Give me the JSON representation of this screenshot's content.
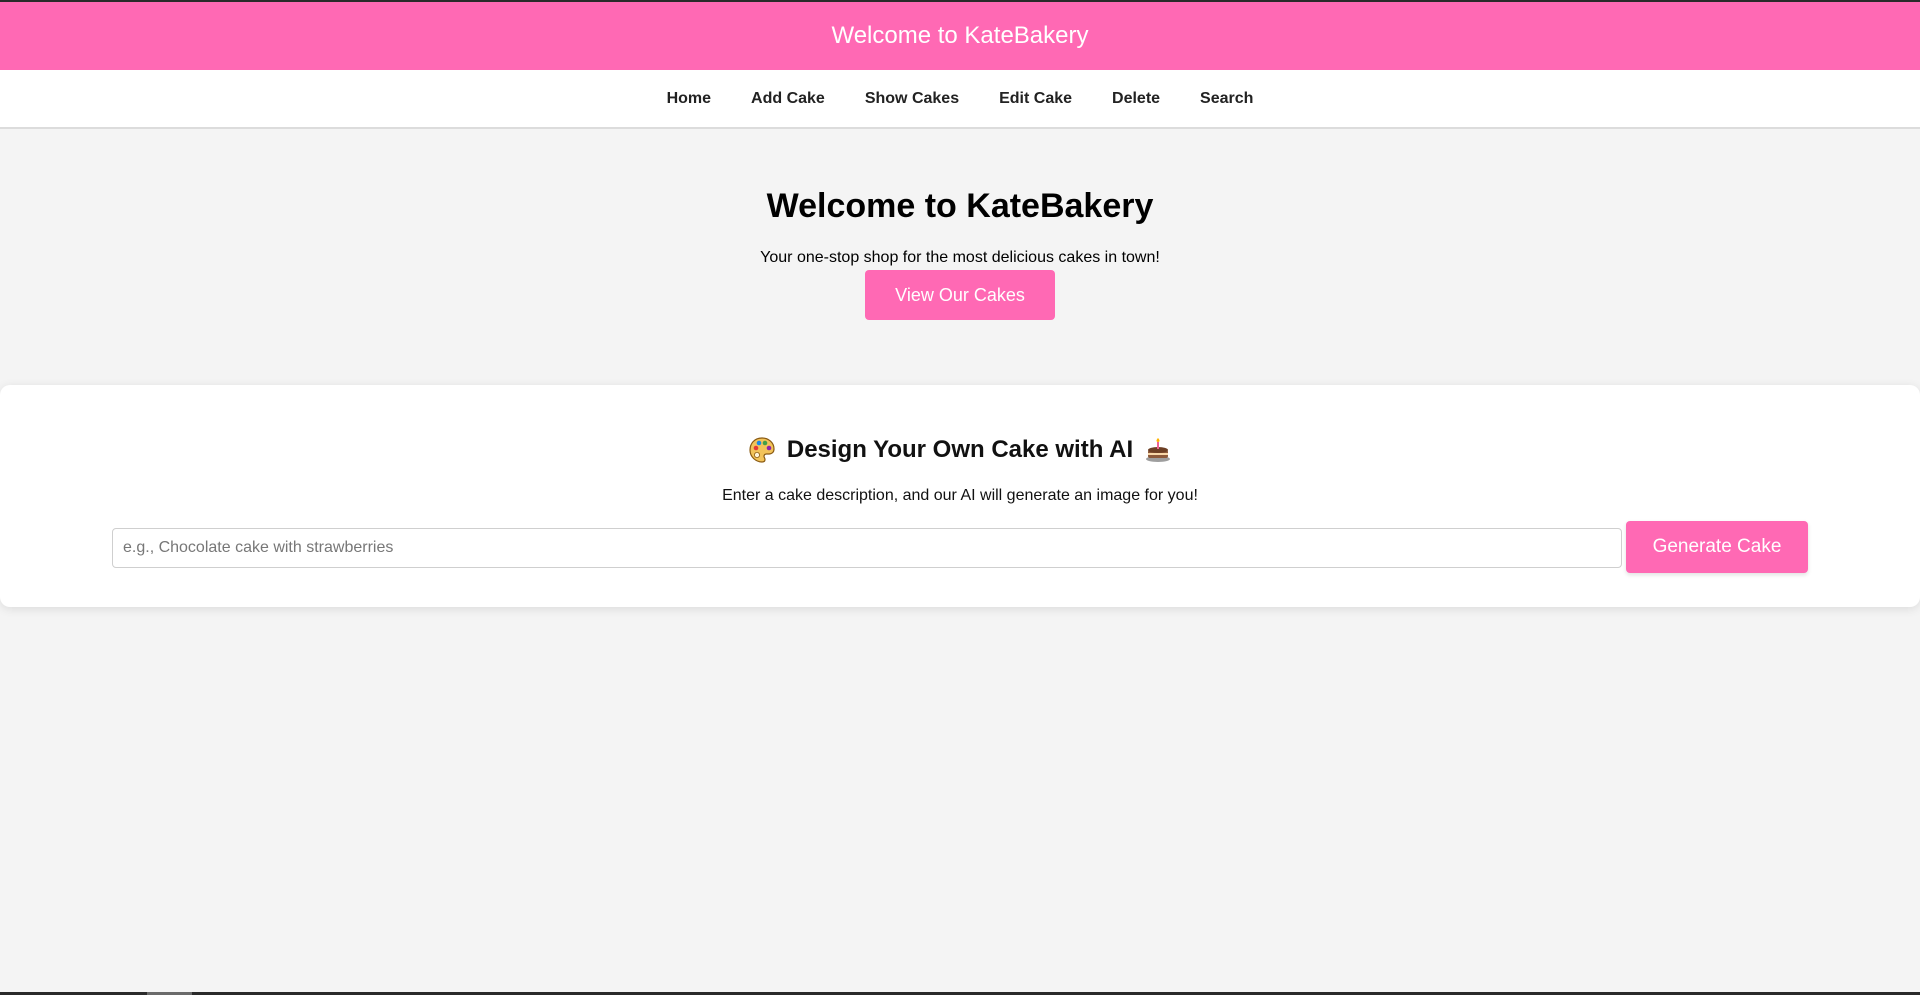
{
  "header": {
    "title": "Welcome to KateBakery"
  },
  "nav": {
    "items": [
      {
        "label": "Home"
      },
      {
        "label": "Add Cake"
      },
      {
        "label": "Show Cakes"
      },
      {
        "label": "Edit Cake"
      },
      {
        "label": "Delete"
      },
      {
        "label": "Search"
      }
    ]
  },
  "hero": {
    "title": "Welcome to KateBakery",
    "subtitle": "Your one-stop shop for the most delicious cakes in town!",
    "button_label": "View Our Cakes"
  },
  "ai_section": {
    "leading_icon": "palette-icon",
    "title": "Design Your Own Cake with AI",
    "trailing_icon": "cake-icon",
    "subtitle": "Enter a cake description, and our AI will generate an image for you!",
    "input_value": "",
    "input_placeholder": "e.g., Chocolate cake with strawberries",
    "button_label": "Generate Cake"
  },
  "colors": {
    "brand_pink": "#ff69b4",
    "page_background": "#f4f4f4",
    "card_background": "#ffffff",
    "header_text": "#ffffff"
  }
}
